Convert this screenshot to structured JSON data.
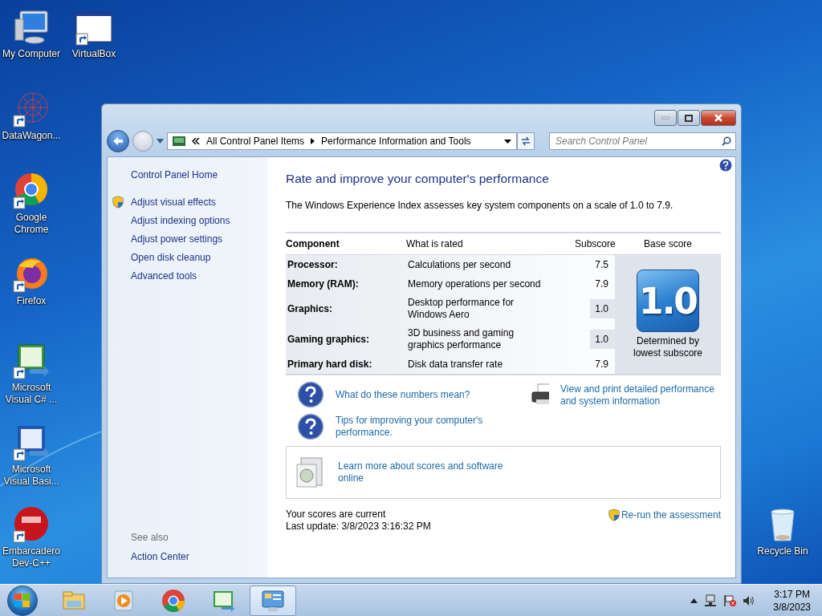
{
  "desktop_icons": [
    {
      "label": "My Computer",
      "kind": "computer",
      "shortcut": false
    },
    {
      "label": "VirtualBox",
      "kind": "window",
      "shortcut": true
    },
    {
      "label": "DataWagon...",
      "kind": "network",
      "shortcut": true
    },
    {
      "label": "Google Chrome",
      "kind": "chrome",
      "shortcut": true
    },
    {
      "label": "Firefox",
      "kind": "firefox",
      "shortcut": true
    },
    {
      "label": "Microsoft Visual C# ...",
      "kind": "csharp",
      "shortcut": true
    },
    {
      "label": "Microsoft Visual Basi...",
      "kind": "vb",
      "shortcut": true
    },
    {
      "label": "Embarcadero Dev-C++",
      "kind": "devcpp",
      "shortcut": true
    },
    {
      "label": "Recycle Bin",
      "kind": "bin",
      "shortcut": false
    }
  ],
  "window": {
    "breadcrumb": [
      "All Control Panel Items",
      "Performance Information and Tools"
    ],
    "search": {
      "placeholder": "Search Control Panel"
    },
    "sidebar": {
      "home": "Control Panel Home",
      "items": [
        {
          "label": "Adjust visual effects",
          "shield": true
        },
        {
          "label": "Adjust indexing options",
          "shield": false
        },
        {
          "label": "Adjust power settings",
          "shield": false
        },
        {
          "label": "Open disk cleanup",
          "shield": false
        },
        {
          "label": "Advanced tools",
          "shield": false
        }
      ],
      "see_also_title": "See also",
      "see_also": [
        "Action Center"
      ]
    },
    "content": {
      "title": "Rate and improve your computer's performance",
      "intro": "The Windows Experience Index assesses key system components on a scale of 1.0 to 7.9.",
      "table": {
        "columns": [
          "Component",
          "What is rated",
          "Subscore",
          "Base score"
        ],
        "rows": [
          {
            "component": "Processor:",
            "rated": "Calculations per second",
            "subscore": "7.5",
            "lowest": false
          },
          {
            "component": "Memory (RAM):",
            "rated": "Memory operations per second",
            "subscore": "7.9",
            "lowest": false
          },
          {
            "component": "Graphics:",
            "rated": "Desktop performance for Windows Aero",
            "subscore": "1.0",
            "lowest": true
          },
          {
            "component": "Gaming graphics:",
            "rated": "3D business and gaming graphics performance",
            "subscore": "1.0",
            "lowest": true
          },
          {
            "component": "Primary hard disk:",
            "rated": "Disk data transfer rate",
            "subscore": "7.9",
            "lowest": false
          }
        ],
        "base_score": "1.0",
        "base_note": "Determined by lowest subscore"
      },
      "help_links": [
        "What do these numbers mean?",
        "Tips for improving your computer's performance."
      ],
      "print_link": "View and print detailed performance and system information",
      "learn_more": "Learn more about scores and software online",
      "status": "Your scores are current",
      "last_update": "Last update: 3/8/2023 3:16:32 PM",
      "rerun": "Re-run the assessment"
    }
  },
  "taskbar": {
    "apps": [
      {
        "kind": "explorer",
        "selected": false
      },
      {
        "kind": "media",
        "selected": false
      },
      {
        "kind": "chrome",
        "selected": false
      },
      {
        "kind": "csharp",
        "selected": false
      },
      {
        "kind": "controlpanel",
        "selected": true
      }
    ],
    "time": "3:17 PM",
    "date": "3/8/2023"
  }
}
